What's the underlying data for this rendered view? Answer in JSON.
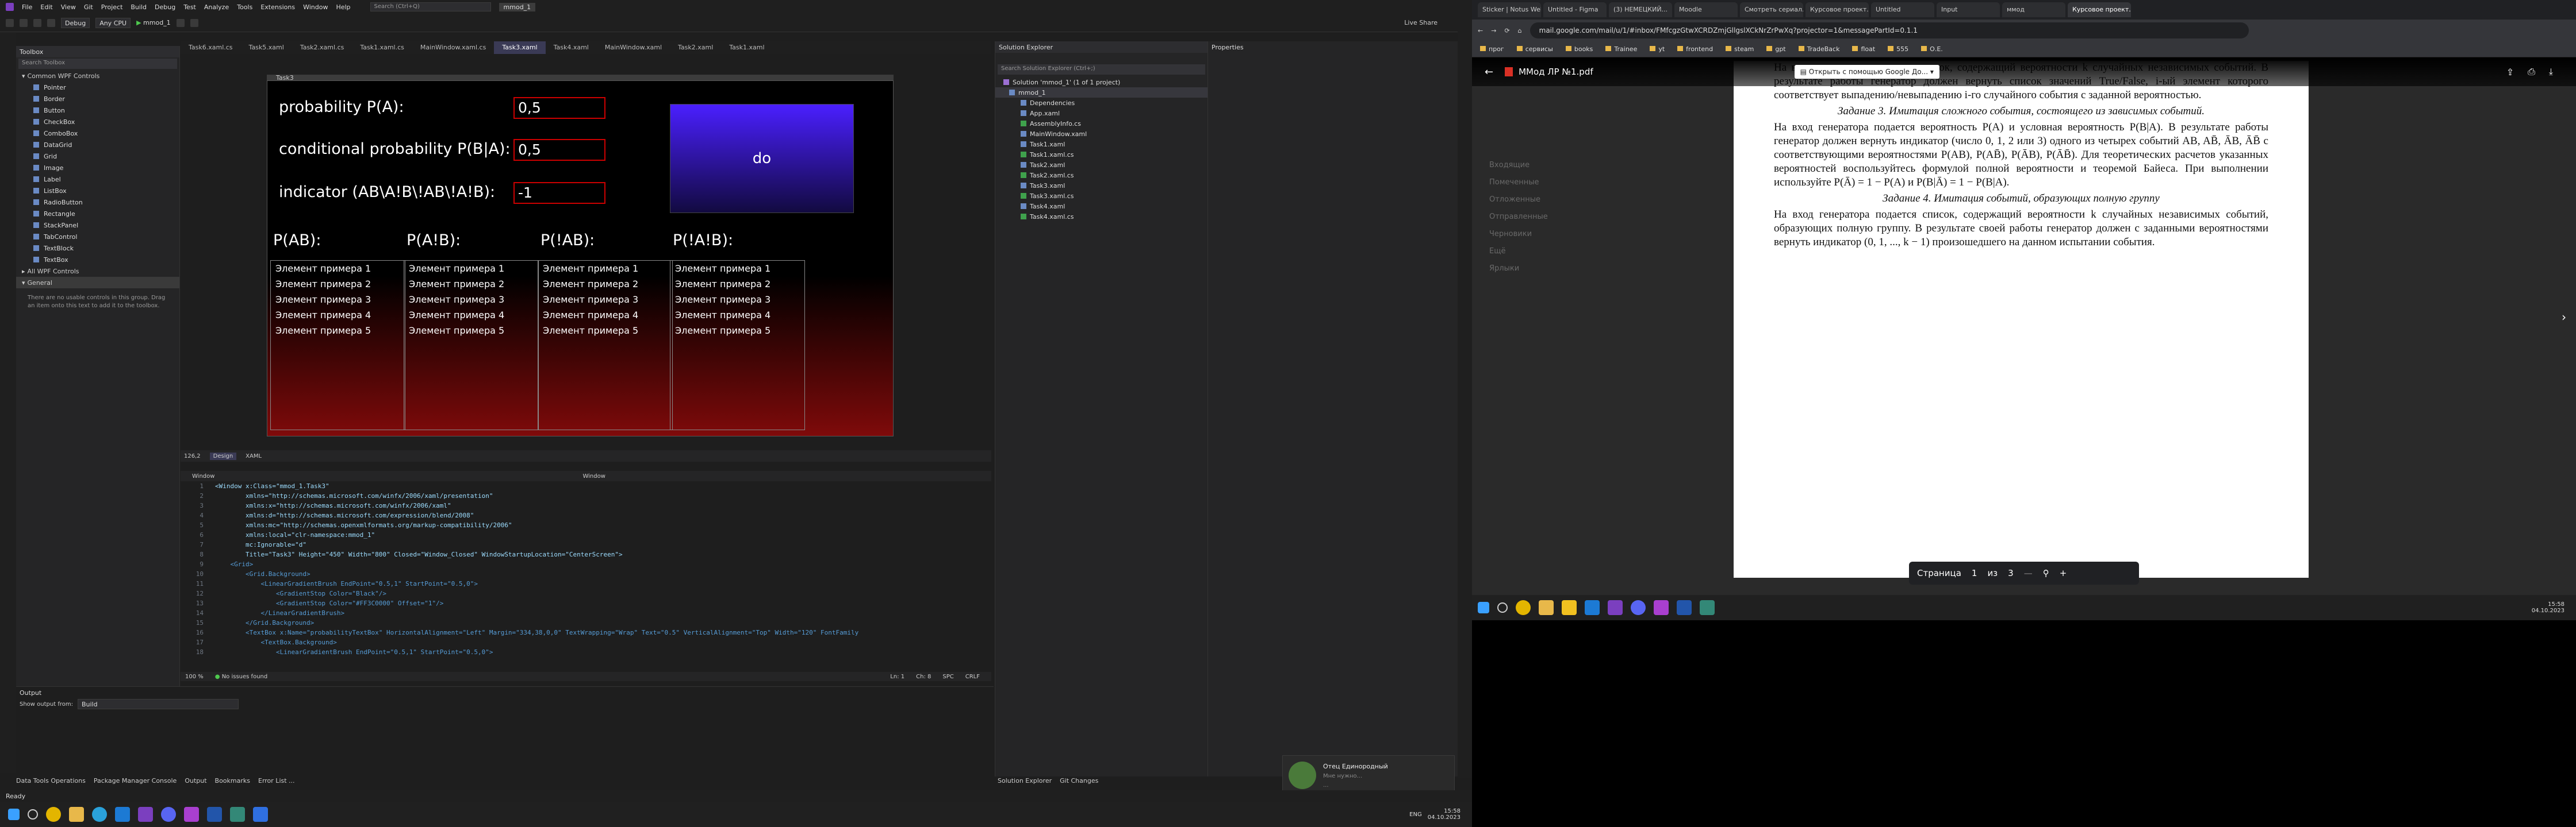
{
  "menu": [
    "File",
    "Edit",
    "View",
    "Git",
    "Project",
    "Build",
    "Debug",
    "Test",
    "Analyze",
    "Tools",
    "Extensions",
    "Window",
    "Help"
  ],
  "search_placeholder": "Search (Ctrl+Q)",
  "project_badge": "mmod_1",
  "toolbar": {
    "config": "Debug",
    "platform": "Any CPU",
    "run": "mmod_1",
    "live_share": "Live Share"
  },
  "toolbox": {
    "title": "Toolbox",
    "search": "Search Toolbox",
    "group": "Common WPF Controls",
    "items": [
      "Pointer",
      "Border",
      "Button",
      "CheckBox",
      "ComboBox",
      "DataGrid",
      "Grid",
      "Image",
      "Label",
      "ListBox",
      "RadioButton",
      "Rectangle",
      "StackPanel",
      "TabControl",
      "TextBlock",
      "TextBox"
    ],
    "all_group": "All WPF Controls",
    "general": "General",
    "empty_msg": "There are no usable controls in this group. Drag an item onto this text to add it to the toolbox."
  },
  "doc_tabs": [
    "Task6.xaml.cs",
    "Task5.xaml",
    "Task2.xaml.cs",
    "Task1.xaml.cs",
    "MainWindow.xaml.cs",
    "Task3.xaml",
    "Task4.xaml",
    "MainWindow.xaml",
    "Task2.xaml",
    "Task1.xaml"
  ],
  "active_tab_index": 5,
  "wpf_window": {
    "title": "Task3",
    "prob_label": "probability P(A):",
    "prob_value": "0,5",
    "cond_label": "conditional probability P(B|A):",
    "cond_value": "0,5",
    "ind_label": "indicator (AB\\A!B\\!AB\\!A!B):",
    "ind_value": "-1",
    "do_label": "do",
    "lists": [
      {
        "header": "P(AB):",
        "items": [
          "Элемент примера 1",
          "Элемент примера 2",
          "Элемент примера 3",
          "Элемент примера 4",
          "Элемент примера 5"
        ]
      },
      {
        "header": "P(A!B):",
        "items": [
          "Элемент примера 1",
          "Элемент примера 2",
          "Элемент примера 3",
          "Элемент примера 4",
          "Элемент примера 5"
        ]
      },
      {
        "header": "P(!AB):",
        "items": [
          "Элемент примера 1",
          "Элемент примера 2",
          "Элемент примера 3",
          "Элемент примера 4",
          "Элемент примера 5"
        ]
      },
      {
        "header": "P(!A!B):",
        "items": [
          "Элемент примера 1",
          "Элемент примера 2",
          "Элемент примера 3",
          "Элемент примера 4",
          "Элемент примера 5"
        ]
      }
    ]
  },
  "designer_footer": {
    "zoom": "126,2",
    "design_tab": "Design",
    "xaml_tab": "XAML",
    "left_scope": "Window",
    "right_scope": "Window"
  },
  "xaml_lines": [
    "<Window x:Class=\"mmod_1.Task3\"",
    "        xmlns=\"http://schemas.microsoft.com/winfx/2006/xaml/presentation\"",
    "        xmlns:x=\"http://schemas.microsoft.com/winfx/2006/xaml\"",
    "        xmlns:d=\"http://schemas.microsoft.com/expression/blend/2008\"",
    "        xmlns:mc=\"http://schemas.openxmlformats.org/markup-compatibility/2006\"",
    "        xmlns:local=\"clr-namespace:mmod_1\"",
    "        mc:Ignorable=\"d\"",
    "        Title=\"Task3\" Height=\"450\" Width=\"800\" Closed=\"Window_Closed\" WindowStartupLocation=\"CenterScreen\">",
    "    <Grid>",
    "        <Grid.Background>",
    "            <LinearGradientBrush EndPoint=\"0.5,1\" StartPoint=\"0.5,0\">",
    "                <GradientStop Color=\"Black\"/>",
    "                <GradientStop Color=\"#FF3C0000\" Offset=\"1\"/>",
    "            </LinearGradientBrush>",
    "        </Grid.Background>",
    "        <TextBox x:Name=\"probabilityTextBox\" HorizontalAlignment=\"Left\" Margin=\"334,38,0,0\" TextWrapping=\"Wrap\" Text=\"0.5\" VerticalAlignment=\"Top\" Width=\"120\" FontFamily",
    "            <TextBox.Background>",
    "                <LinearGradientBrush EndPoint=\"0.5,1\" StartPoint=\"0.5,0\">"
  ],
  "xaml_footer": {
    "zoom": "100 %",
    "issues": "No issues found",
    "ln": "Ln: 1",
    "ch": "Ch: 8",
    "enc": "SPC",
    "eol": "CRLF"
  },
  "output": {
    "title": "Output",
    "show_from": "Show output from:",
    "source": "Build"
  },
  "bottom_tabs": [
    "Data Tools Operations",
    "Package Manager Console",
    "Output",
    "Bookmarks",
    "Error List ..."
  ],
  "bottom_tabs_right": [
    "Solution Explorer",
    "Git Changes"
  ],
  "solution": {
    "title": "Solution Explorer",
    "search": "Search Solution Explorer (Ctrl+;)",
    "items": [
      "Solution 'mmod_1' (1 of 1 project)",
      "mmod_1",
      "Dependencies",
      "App.xaml",
      "AssemblyInfo.cs",
      "MainWindow.xaml",
      "Task1.xaml",
      "Task1.xaml.cs",
      "Task2.xaml",
      "Task2.xaml.cs",
      "Task3.xaml",
      "Task3.xaml.cs",
      "Task4.xaml",
      "Task4.xaml.cs"
    ]
  },
  "properties": {
    "title": "Properties"
  },
  "status": {
    "ready": "Ready"
  },
  "notification": {
    "name": "Отец Единородный",
    "line1": "Мне нужно...",
    "line2": "..."
  },
  "clock": {
    "time": "15:58",
    "date": "04.10.2023",
    "lang": "ENG"
  },
  "chrome": {
    "tabs": [
      "Sticker | Notus Web",
      "Untitled - Figma",
      "(3) НЕМЕЦКИЙ...",
      "Moodle",
      "Смотреть сериал...",
      "Курсовое проект...",
      "Untitled",
      "Input",
      "ммод",
      "Курсовое проект..."
    ],
    "url": "mail.google.com/mail/u/1/#inbox/FMfcgzGtwXCRDZmjGllgslXCkNrZrPwXq?projector=1&messagePartId=0.1.1",
    "bookmarks": [
      "прог",
      "сервисы",
      "books",
      "Trainee",
      "yt",
      "frontend",
      "steam",
      "gpt",
      "TradeBack",
      "float",
      "555",
      "О.Е."
    ],
    "pdf_title": "ММод ЛР №1.pdf",
    "open_with": "Открыть с помощью Google До...",
    "page_label": "Страница",
    "page_current": "1",
    "page_of": "из",
    "page_total": "3"
  },
  "pdf_text": {
    "p1": "На вход генератора подается список, содержащий вероятности k случайных независимых событий. В результате работы генератор должен вернуть список значений True/False, i-ый элемент которого соответствует выпадению/невыпадению i-го случайного события с заданной вероятностью.",
    "task3": "Задание 3. Имитация сложного события, состоящего из зависимых событий.",
    "p2": "На вход генератора подается вероятность P(A) и условная вероятность P(B|A). В результате работы генератор должен вернуть индикатор (число 0, 1, 2 или 3) одного из четырех событий AB, AB̄, ĀB, ĀB̄ с соответствующими вероятностями P(AB), P(AB̄), P(ĀB), P(ĀB̄). Для теоретических расчетов указанных вероятностей воспользуйтесь формулой полной вероятности и теоремой Байеса. При выполнении используйте P(Ā) = 1 − P(A) и P(B|Ā) = 1 − P(B|A).",
    "task4": "Задание 4. Имитация событий, образующих полную группу",
    "p3": "На вход генератора подается список, содержащий вероятности k случайных независимых событий, образующих полную группу. В результате своей работы генератор должен с заданными вероятностями вернуть индикатор (0, 1, ..., k − 1) произошедшего на данном испытании события."
  },
  "gmail_side": [
    "Входящие",
    "Помеченные",
    "Отложенные",
    "Отправленные",
    "Черновики",
    "Ещё",
    "Ярлыки"
  ]
}
